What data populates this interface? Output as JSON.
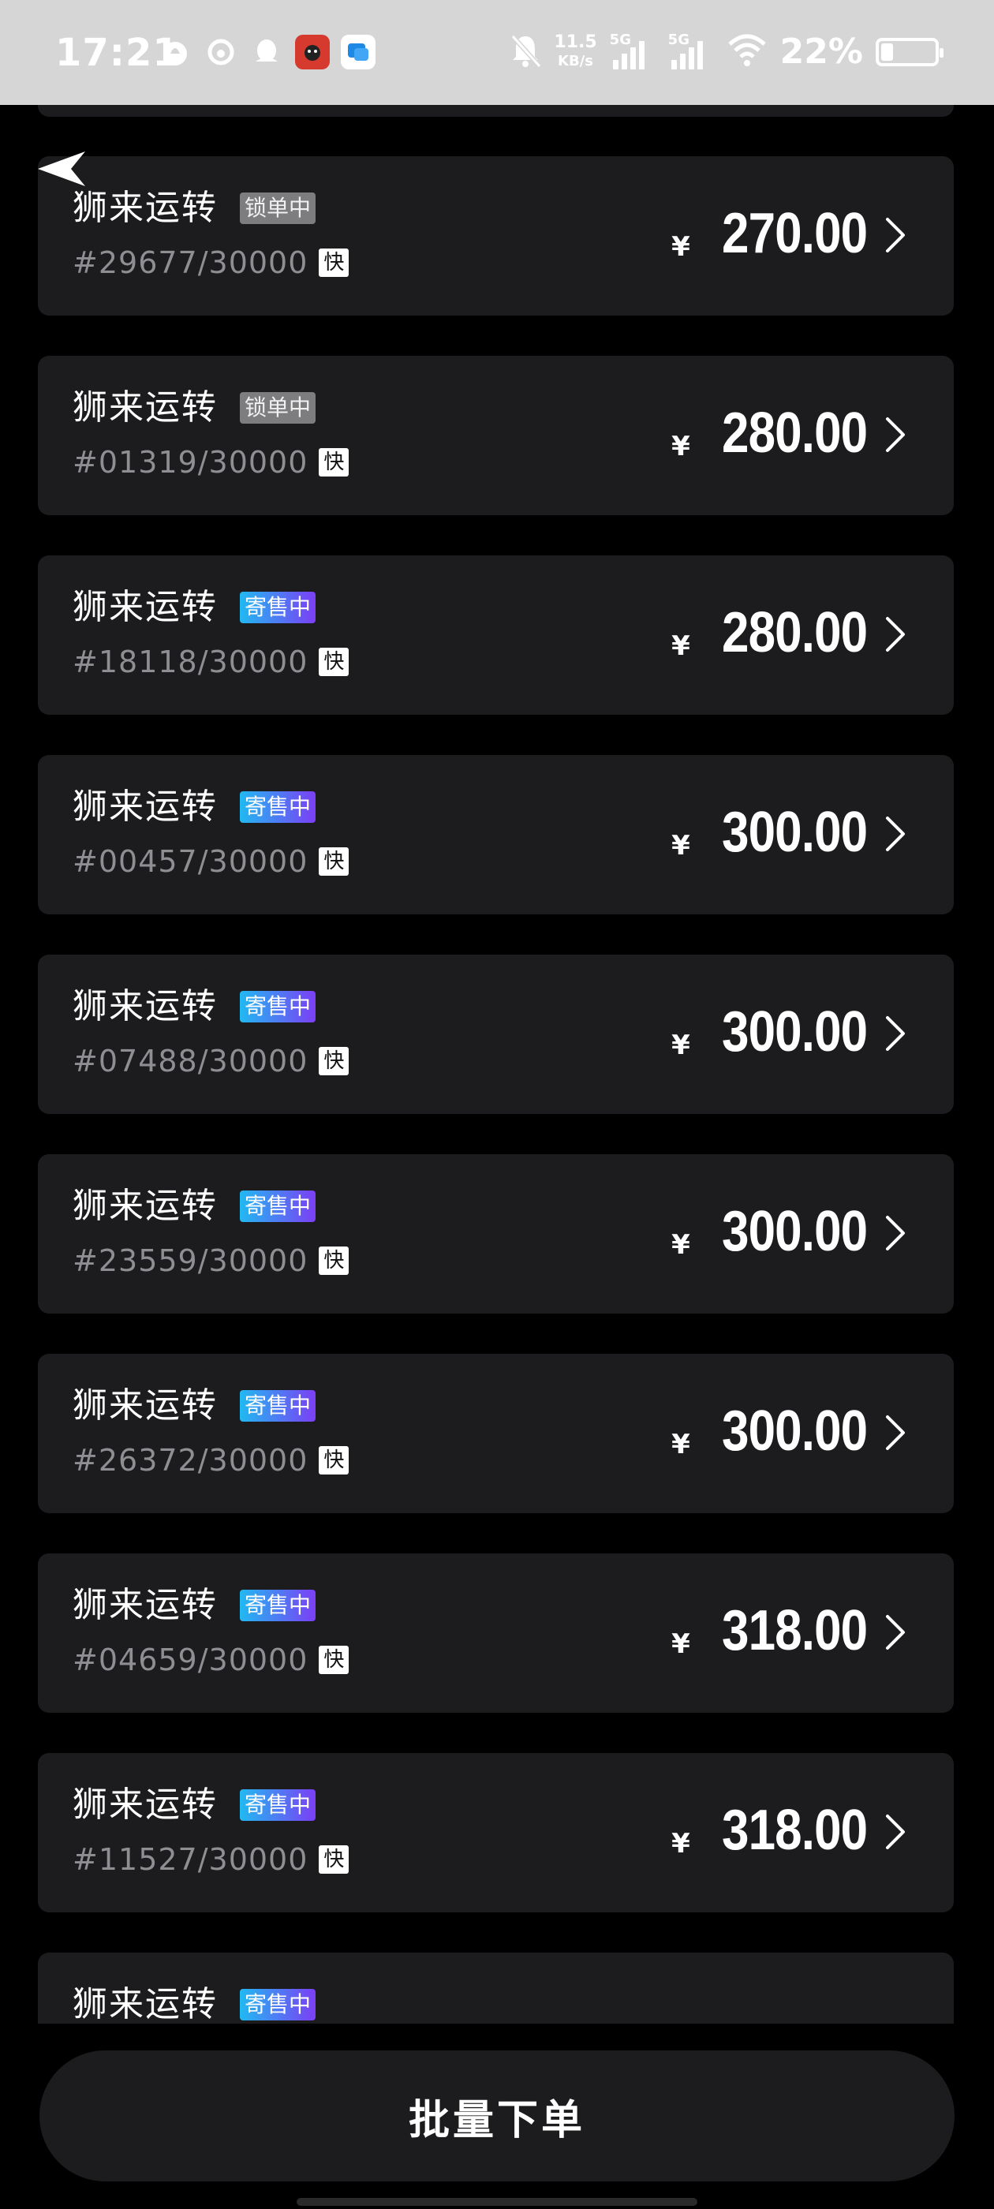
{
  "status_bar": {
    "time": "17:21",
    "net_speed_value": "11.5",
    "net_speed_unit": "KB/s",
    "signal1_label": "5G",
    "signal2_label": "5G",
    "battery_percent_text": "22%",
    "battery_level": 0.22,
    "icons": [
      "flame-icon",
      "swirl-icon",
      "qq-icon",
      "red-app-icon",
      "blue-app-icon",
      "bell-off-icon",
      "wifi-icon"
    ]
  },
  "colors": {
    "background": "#000000",
    "card": "#1c1c1e",
    "locked_tag": "#7d7d7f",
    "selling_tag_start": "#21b9f2",
    "selling_tag_end": "#7b3ff5",
    "serial_text": "#8e8e93"
  },
  "items": [
    {
      "name": "狮来运转",
      "status": "锁单中",
      "status_type": "locked",
      "serial": "#29677/30000",
      "fast": "快",
      "currency": "¥",
      "price": "270.00"
    },
    {
      "name": "狮来运转",
      "status": "锁单中",
      "status_type": "locked",
      "serial": "#01319/30000",
      "fast": "快",
      "currency": "¥",
      "price": "280.00"
    },
    {
      "name": "狮来运转",
      "status": "寄售中",
      "status_type": "selling",
      "serial": "#18118/30000",
      "fast": "快",
      "currency": "¥",
      "price": "280.00"
    },
    {
      "name": "狮来运转",
      "status": "寄售中",
      "status_type": "selling",
      "serial": "#00457/30000",
      "fast": "快",
      "currency": "¥",
      "price": "300.00"
    },
    {
      "name": "狮来运转",
      "status": "寄售中",
      "status_type": "selling",
      "serial": "#07488/30000",
      "fast": "快",
      "currency": "¥",
      "price": "300.00"
    },
    {
      "name": "狮来运转",
      "status": "寄售中",
      "status_type": "selling",
      "serial": "#23559/30000",
      "fast": "快",
      "currency": "¥",
      "price": "300.00"
    },
    {
      "name": "狮来运转",
      "status": "寄售中",
      "status_type": "selling",
      "serial": "#26372/30000",
      "fast": "快",
      "currency": "¥",
      "price": "300.00"
    },
    {
      "name": "狮来运转",
      "status": "寄售中",
      "status_type": "selling",
      "serial": "#04659/30000",
      "fast": "快",
      "currency": "¥",
      "price": "318.00"
    },
    {
      "name": "狮来运转",
      "status": "寄售中",
      "status_type": "selling",
      "serial": "#11527/30000",
      "fast": "快",
      "currency": "¥",
      "price": "318.00"
    },
    {
      "name": "狮来运转",
      "status": "寄售中",
      "status_type": "selling",
      "serial": "",
      "fast": "",
      "currency": "",
      "price": ""
    }
  ],
  "bottom": {
    "batch_button_label": "批量下单"
  }
}
